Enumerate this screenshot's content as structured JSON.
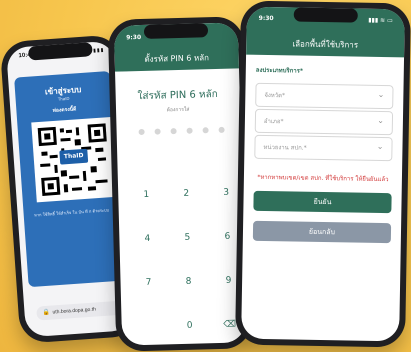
{
  "phone1": {
    "status_time": "10:44",
    "title": "เข้าสู่ระบบ",
    "subtitle": "ThaID",
    "label": "ท่องตรงนี้ดี",
    "qr_logo": "ThaID",
    "note": "หาก ใช้สิทธิ์ ให้สำเร็จ ใน บัน ทึ ก ด้วยระบบ",
    "url": "uth.bora.dopa.go.th"
  },
  "phone2": {
    "status_time": "9:30",
    "title": "ตั้งรหัส PIN 6 หลัก",
    "heading": "ใส่รหัส PIN 6 หลัก",
    "sub": "ต้องการใส่",
    "keys": [
      "1",
      "2",
      "3",
      "4",
      "5",
      "6",
      "7",
      "8",
      "9",
      "0"
    ]
  },
  "phone3": {
    "status_time": "9:30",
    "title": "เลือกพื้นที่ใช้บริการ",
    "section": "ลงประเภทบริการ*",
    "fields": [
      {
        "placeholder": "จังหวัด*"
      },
      {
        "placeholder": "อำเภอ*"
      },
      {
        "placeholder": "หน่วยงาน สปก.*"
      }
    ],
    "warning": "*หากหาพบเขต/เขต สปก. ที่ใช้บริการ\nให้ยืนยันแล้ว",
    "confirm_label": "ยืนยัน",
    "back_label": "ย้อนกลับ"
  }
}
